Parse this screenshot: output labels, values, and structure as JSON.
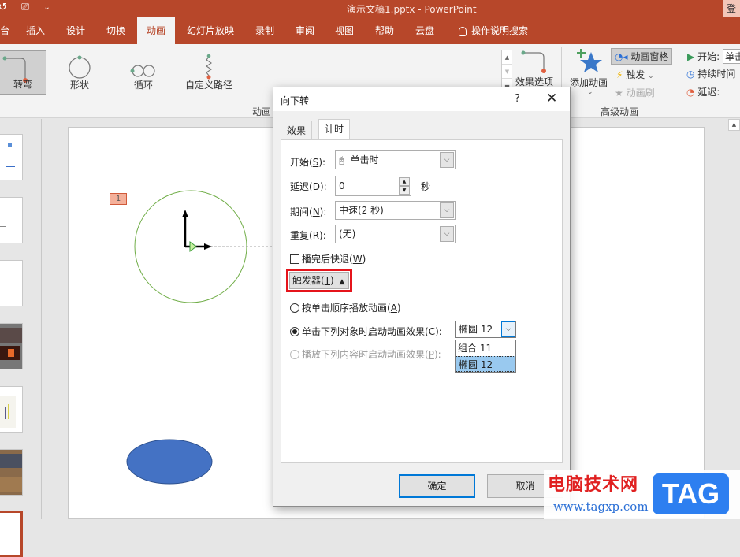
{
  "window": {
    "title": "演示文稿1.pptx  -  PowerPoint",
    "login_label": "登"
  },
  "qat": {
    "undo_icon": "↺",
    "present_icon": "⎚",
    "customize_icon": "⌄"
  },
  "tabs": [
    {
      "label": "台"
    },
    {
      "label": "插入"
    },
    {
      "label": "设计"
    },
    {
      "label": "切换"
    },
    {
      "label": "动画",
      "active": true
    },
    {
      "label": "幻灯片放映"
    },
    {
      "label": "录制"
    },
    {
      "label": "审阅"
    },
    {
      "label": "视图"
    },
    {
      "label": "帮助"
    },
    {
      "label": "云盘"
    },
    {
      "label": "操作说明搜索"
    }
  ],
  "ribbon": {
    "gallery": [
      {
        "label": "转弯",
        "selected": true
      },
      {
        "label": "形状"
      },
      {
        "label": "循环"
      },
      {
        "label": "自定义路径"
      }
    ],
    "effect_options_label": "效果选项",
    "animation_group_label": "动画",
    "add_animation_label": "添加动画",
    "animation_pane_label": "动画窗格",
    "trigger_label": "触发",
    "animation_painter_label": "动画刷",
    "advanced_group_label": "高级动画",
    "start_label": "开始:",
    "start_value": "单击",
    "duration_label": "持续时间",
    "delay_label": "延迟:"
  },
  "slide": {
    "animation_badge": "1"
  },
  "dialog": {
    "title": "向下转",
    "help": "?",
    "close": "✕",
    "tabs": [
      {
        "label": "效果"
      },
      {
        "label": "计时",
        "active": true
      }
    ],
    "start": {
      "label_pre": "开始(",
      "key": "S",
      "label_post": "):",
      "value": "单击时"
    },
    "delay": {
      "label_pre": "延迟(",
      "key": "D",
      "label_post": "):",
      "value": "0",
      "unit": "秒"
    },
    "duration": {
      "label_pre": "期间(",
      "key": "N",
      "label_post": "):",
      "value": "中速(2 秒)"
    },
    "repeat": {
      "label_pre": "重复(",
      "key": "R",
      "label_post": "):",
      "value": "(无)"
    },
    "rewind": {
      "label_pre": "播完后快退(",
      "key": "W",
      "label_post": ")",
      "checked": false
    },
    "trigger_button": {
      "label_pre": "触发器(",
      "key": "T",
      "label_post": ")",
      "icon": "▲"
    },
    "option_sequence": {
      "label_pre": "按单击顺序播放动画(",
      "key": "A",
      "label_post": ")",
      "selected": false
    },
    "option_click_object": {
      "label_pre": "单击下列对象时启动动画效果(",
      "key": "C",
      "label_post": "):",
      "selected": true,
      "value": "椭圆 12"
    },
    "option_play_content": {
      "label_pre": "播放下列内容时启动动画效果(",
      "key": "P",
      "label_post": "):",
      "selected": false,
      "disabled": true
    },
    "dropdown_options": [
      {
        "label": "组合 11"
      },
      {
        "label": "椭圆 12",
        "selected": true
      }
    ],
    "ok_label": "确定",
    "cancel_label": "取消"
  },
  "watermark": {
    "site_name": "电脑技术网",
    "url": "www.tagxp.com",
    "badge": "TAG"
  },
  "colors": {
    "brand": "#b7472a",
    "highlight_box": "#e5141b",
    "primary_button_border": "#0078d7",
    "ellipse_fill": "#4472c4",
    "circle_stroke": "#70ad47"
  }
}
